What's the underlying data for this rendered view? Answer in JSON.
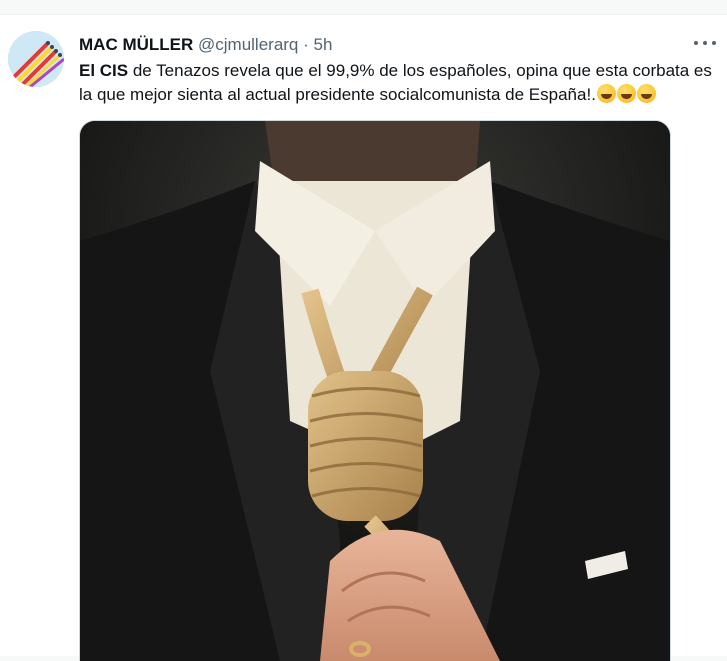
{
  "tweet": {
    "author_name": "MAC MÜLLER",
    "author_handle": "@cjmullerarq",
    "separator": "·",
    "time": "5h",
    "text_bold": "El CIS",
    "text_rest": " de Tenazos revela que el 99,9% de los españoles, opina que esta corbata es la que mejor sienta al actual presidente socialcomunista de España!.",
    "emoji_count": 3,
    "emoji_name": "rolling-on-the-floor-laughing-icon"
  },
  "colors": {
    "text": "#0f1419",
    "secondary": "#536471",
    "background": "#ffffff"
  }
}
